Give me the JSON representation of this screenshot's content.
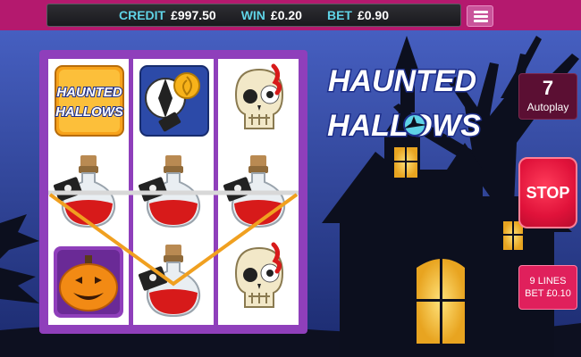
{
  "meters": {
    "credit_label": "CREDIT",
    "credit_value": "£997.50",
    "win_label": "WIN",
    "win_value": "£0.20",
    "bet_label": "BET",
    "bet_value": "£0.90"
  },
  "logo": {
    "line1": "HAUNTED",
    "line2": "HALLOWS"
  },
  "autoplay": {
    "count": "7",
    "label": "Autoplay"
  },
  "stop_label": "STOP",
  "lines_bet": {
    "lines": "9 LINES",
    "bet": "BET £0.10"
  },
  "reels": [
    [
      "haunted-hallows-logo-symbol",
      "potion-symbol",
      "pumpkin-symbol"
    ],
    [
      "lollipop-symbol",
      "potion-symbol",
      "potion-symbol"
    ],
    [
      "skull-symbol",
      "potion-symbol",
      "skull-symbol"
    ]
  ],
  "colors": {
    "top_bar": "#b4196e",
    "reel_frame": "#8f3fbb",
    "stop_button": "#e0123a",
    "win_line": "#f0a020",
    "meter_label": "#5fd3e6"
  }
}
